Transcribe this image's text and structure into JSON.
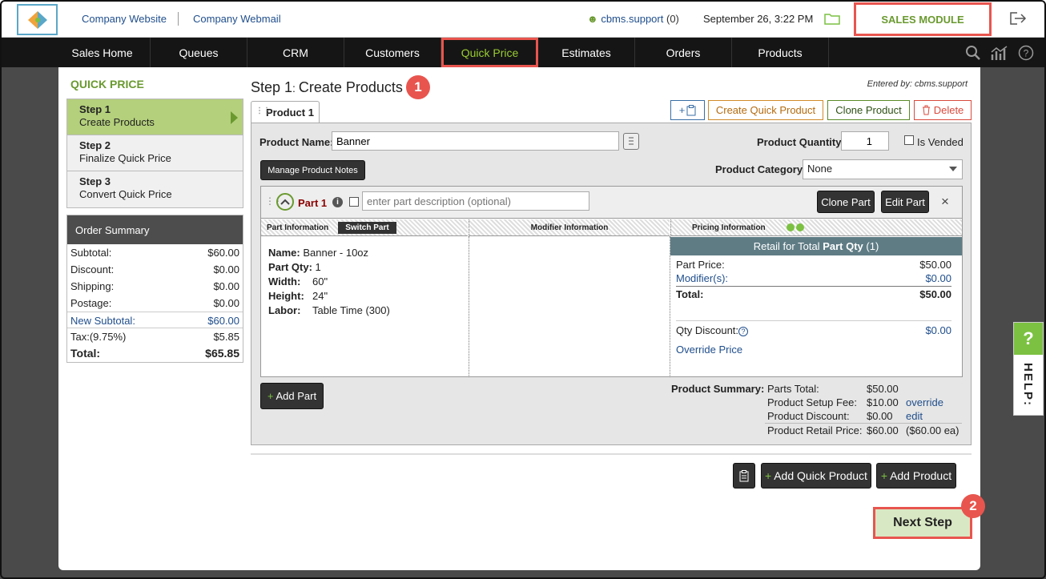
{
  "header": {
    "links": [
      "Company Website",
      "Company Webmail"
    ],
    "user": "cbms.support",
    "user_count": "(0)",
    "datetime": "September 26, 3:22 PM",
    "module": "SALES MODULE"
  },
  "nav": {
    "items": [
      "Sales Home",
      "Queues",
      "CRM",
      "Customers",
      "Quick Price",
      "Estimates",
      "Orders",
      "Products"
    ],
    "active": "Quick Price"
  },
  "sidebar": {
    "title": "QUICK PRICE",
    "steps": [
      {
        "label": "Step 1",
        "desc": "Create Products"
      },
      {
        "label": "Step 2",
        "desc": "Finalize Quick Price"
      },
      {
        "label": "Step 3",
        "desc": "Convert Quick Price"
      }
    ],
    "summary": {
      "title": "Order Summary",
      "rows": [
        {
          "label": "Subtotal:",
          "value": "$60.00"
        },
        {
          "label": "Discount:",
          "value": "$0.00"
        },
        {
          "label": "Shipping:",
          "value": "$0.00"
        },
        {
          "label": "Postage:",
          "value": "$0.00"
        },
        {
          "label": "New Subtotal:",
          "value": "$60.00"
        },
        {
          "label": "Tax:(9.75%)",
          "value": "$5.85"
        },
        {
          "label": "Total:",
          "value": "$65.85"
        }
      ]
    }
  },
  "main": {
    "step_prefix": "Step 1",
    "step_title": "Create Products",
    "entered_by": "Entered by: cbms.support",
    "tab": "Product 1",
    "buttons": {
      "add": "+",
      "create_quick": "Create Quick Product",
      "clone": "Clone Product",
      "delete": "Delete"
    },
    "product_name_label": "Product Name:",
    "product_name": "Banner",
    "qty_label": "Product Quantity:",
    "qty": "1",
    "vended": "Is Vended",
    "notes_btn": "Manage Product Notes",
    "category_label": "Product Category:",
    "category": "None",
    "part": {
      "label": "Part 1",
      "placeholder": "enter part description (optional)",
      "clone": "Clone Part",
      "edit": "Edit Part",
      "close": "×",
      "col_part": "Part Information",
      "switch": "Switch Part",
      "col_mod": "Modifier Information",
      "col_price": "Pricing Information",
      "info": [
        {
          "k": "Name:",
          "v": "Banner - 10oz"
        },
        {
          "k": "Part Qty:",
          "v": "1"
        },
        {
          "k": "Width:",
          "v": "60\""
        },
        {
          "k": "Height:",
          "v": "24\""
        },
        {
          "k": "Labor:",
          "v": "Table Time (300)"
        }
      ],
      "retail_head": "Retail for Total",
      "retail_bold": "Part Qty",
      "retail_qty": "(1)",
      "part_price_label": "Part Price:",
      "part_price": "$50.00",
      "modifiers_label": "Modifier(s):",
      "modifiers": "$0.00",
      "total_label": "Total:",
      "total": "$50.00",
      "qty_discount_label": "Qty Discount:",
      "qty_discount": "$0.00",
      "override": "Override Price"
    },
    "add_part": "Add Part",
    "product_summary": {
      "title": "Product Summary:",
      "rows": [
        {
          "label": "Parts Total:",
          "value": "$50.00",
          "link": ""
        },
        {
          "label": "Product Setup Fee:",
          "value": "$10.00",
          "link": "override"
        },
        {
          "label": "Product Discount:",
          "value": "$0.00",
          "link": "edit"
        },
        {
          "label": "Product Retail Price:",
          "value": "$60.00",
          "link": "($60.00 ea)"
        }
      ]
    },
    "add_quick_product": "Add Quick Product",
    "add_product": "Add Product",
    "next_step": "Next Step",
    "badges": [
      "1",
      "2"
    ]
  },
  "help": {
    "q": "?",
    "label": "HELP:"
  }
}
